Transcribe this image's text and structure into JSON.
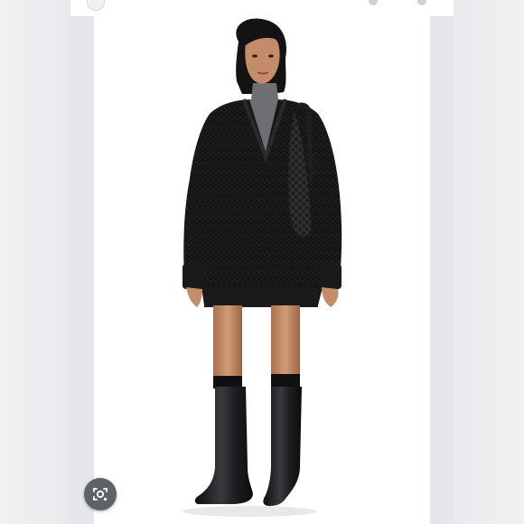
{
  "image": {
    "alt": "",
    "colors": {
      "background": "#ffffff",
      "sweater": "#121212",
      "turtleneck": "#6e6f72",
      "boots": "#1b1b1d",
      "skin": "#c48c69",
      "hair": "#141212",
      "lens_button": "#5f6368"
    }
  },
  "controls": {
    "visual_search_icon": "camera-lens-icon",
    "top_left_icon": "share-icon",
    "top_right_icons": [
      "bookmark-icon",
      "more-icon"
    ]
  }
}
